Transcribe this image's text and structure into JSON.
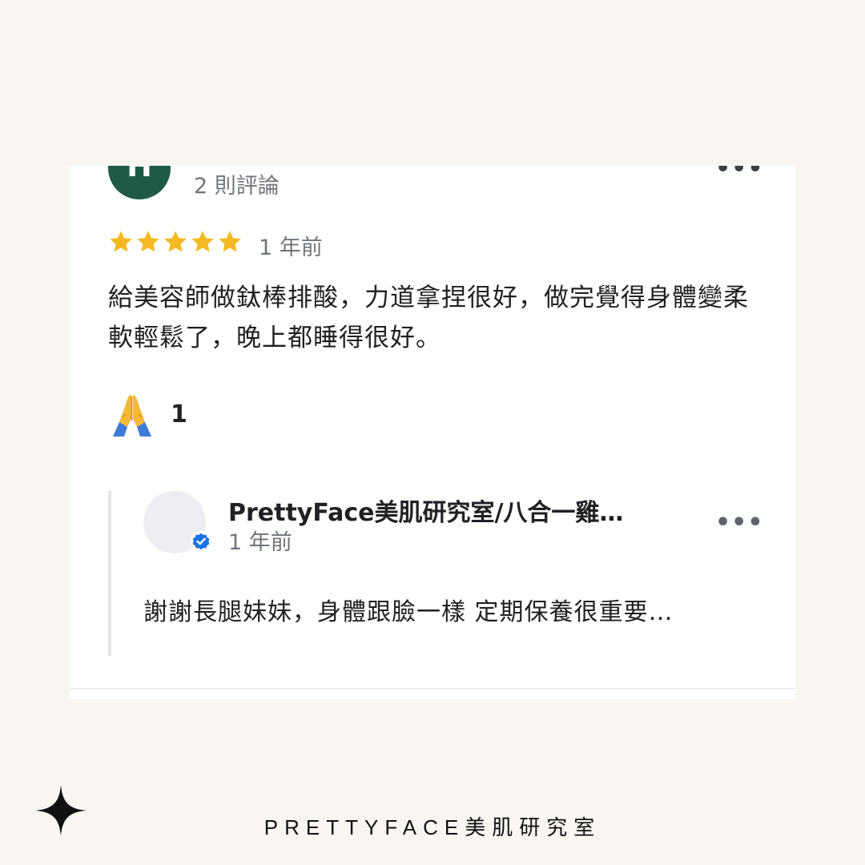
{
  "review": {
    "avatar_initial": "H",
    "review_count": "2 則評論",
    "more_label": "•••",
    "rating": 5,
    "rating_max": 5,
    "star_color": "#f5b921",
    "time": "1 年前",
    "text": "給美容師做鈦棒排酸，力道拿捏很好，做完覺得身體變柔軟輕鬆了，晚上都睡得很好。",
    "reaction_icon": "folded-hands-emoji",
    "reaction_count": "1"
  },
  "reply": {
    "owner_name": "PrettyFace美肌研究室/八合一雞…",
    "verified_icon": "verified-badge-icon",
    "time": "1 年前",
    "more_label": "•••",
    "text": "謝謝長腿妹妹，身體跟臉一樣 定期保養很重要…"
  },
  "footer": {
    "brand": "PRETTYFACE美肌研究室",
    "sparkle_icon": "sparkle-icon"
  },
  "colors": {
    "background": "#f9f6f1",
    "card": "#ffffff",
    "avatar": "#1e5a45",
    "secondary_text": "#70757a",
    "verified_blue": "#1a73e8"
  }
}
